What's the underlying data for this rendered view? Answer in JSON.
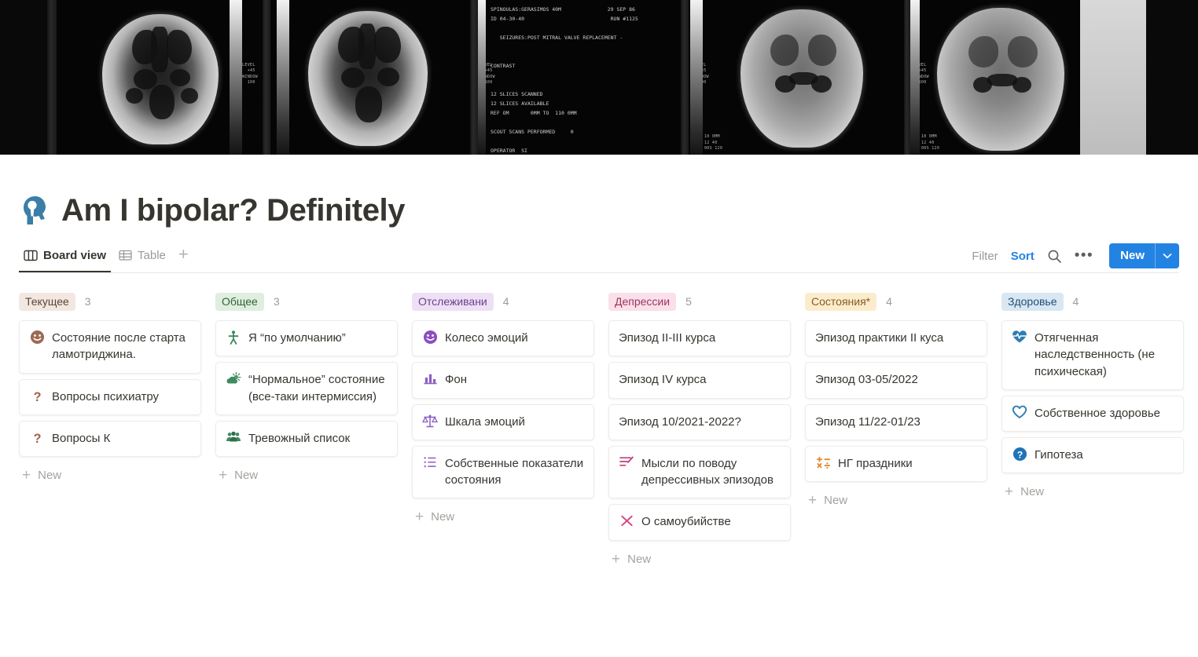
{
  "cover": {
    "alt": "ct-scan-film-cover",
    "scan_overlay_text": "SPINOULAS:GERASIMOS 40M               29 SEP 86\nID 04-30-40                            RUN #1125\n\n   SEIZURES:POST MITRAL VALVE REPLACEMENT -\n\n\nCONTRAST\n\n\n12 SLICES SCANNED\n12 SLICES AVAILABLE\nREF OM       0MM TO  110 0MM\n\nSCOUT SCANS PERFORMED     0\n\nOPERATOR  SI\nPHYSICIAN  JETT\nRADIOLOGIST  KRUDY",
    "side_label": "LEVEL\n  +45\nWINDOW\n  100",
    "corner_label": "10 0MM\n12 40\n00S 120"
  },
  "header": {
    "title": "Am I bipolar? Definitely",
    "icon": "head-keyhole-icon"
  },
  "viewbar": {
    "tabs": [
      {
        "label": "Board view",
        "icon": "board-view-icon",
        "active": true
      },
      {
        "label": "Table",
        "icon": "table-view-icon",
        "active": false
      }
    ],
    "add_view_label": "+",
    "toolbar": {
      "filter_label": "Filter",
      "sort_label": "Sort",
      "search_icon": "search-icon",
      "more_icon": "more-dots-icon",
      "new_label": "New",
      "new_caret_icon": "chevron-down-icon"
    }
  },
  "accent_colors": {
    "brand_blue": "#2383e2",
    "text": "#37352f",
    "muted": "#9b9a97"
  },
  "board": {
    "new_label": "New",
    "columns": [
      {
        "tag": "Текущее",
        "tag_bg": "#f3e7e1",
        "tag_fg": "#5b4438",
        "count": "3",
        "cards": [
          {
            "title": "Состояние после старта ламотриджина.",
            "icon": "smiley-face-icon",
            "icon_color": "#9b6b53"
          },
          {
            "title": "Вопросы психиатру",
            "icon": "question-mark-icon",
            "icon_color": "#a1644a"
          },
          {
            "title": "Вопросы К",
            "icon": "question-mark-icon",
            "icon_color": "#a1644a"
          }
        ]
      },
      {
        "tag": "Общее",
        "tag_bg": "#dfeede",
        "tag_fg": "#33623b",
        "count": "3",
        "cards": [
          {
            "title": "Я “по умолчанию”",
            "icon": "person-standing-icon",
            "icon_color": "#3d8a5f"
          },
          {
            "title": "“Нормальное” состояние (все-таки интермиссия)",
            "icon": "sun-behind-cloud-icon",
            "icon_color": "#3f8a62"
          },
          {
            "title": "Тревожный список",
            "icon": "people-group-icon",
            "icon_color": "#3f8a62"
          }
        ]
      },
      {
        "tag": "Отслеживани",
        "tag_bg": "#eee0f4",
        "tag_fg": "#6b3f8f",
        "count": "4",
        "cards": [
          {
            "title": "Колесо эмоций",
            "icon": "smiley-face-icon",
            "icon_color": "#8b4ec0"
          },
          {
            "title": "Фон",
            "icon": "bar-chart-icon",
            "icon_color": "#8b5fc4"
          },
          {
            "title": "Шкала эмоций",
            "icon": "balance-scale-icon",
            "icon_color": "#8b5fc4"
          },
          {
            "title": "Собственные показатели состояния",
            "icon": "bullet-list-icon",
            "icon_color": "#9a6ccc"
          }
        ]
      },
      {
        "tag": "Депрессии",
        "tag_bg": "#fae0e9",
        "tag_fg": "#9c3462",
        "count": "5",
        "cards": [
          {
            "title": "Эпизод II-III курса",
            "icon": "",
            "icon_color": ""
          },
          {
            "title": "Эпизод IV курса",
            "icon": "",
            "icon_color": ""
          },
          {
            "title": "Эпизод 10/2021-2022?",
            "icon": "",
            "icon_color": ""
          },
          {
            "title": "Мысли по поводу депрессивных эпизодов",
            "icon": "edit-note-icon",
            "icon_color": "#c1407f"
          },
          {
            "title": "О самоубийстве",
            "icon": "cross-x-icon",
            "icon_color": "#d6457f"
          }
        ]
      },
      {
        "tag": "Состояния*",
        "tag_bg": "#fbeccd",
        "tag_fg": "#8a5b22",
        "count": "4",
        "cards": [
          {
            "title": "Эпизод практики II куса",
            "icon": "",
            "icon_color": ""
          },
          {
            "title": "Эпизод 03-05/2022",
            "icon": "",
            "icon_color": ""
          },
          {
            "title": "Эпизод 11/22-01/23",
            "icon": "",
            "icon_color": ""
          },
          {
            "title": "НГ праздники",
            "icon": "math-symbols-icon",
            "icon_color": "#e08b2a"
          }
        ]
      },
      {
        "tag": "Здоровье",
        "tag_bg": "#d9e7f2",
        "tag_fg": "#1f4e79",
        "count": "4",
        "cards": [
          {
            "title": "Отягченная наследственность (не психическая)",
            "icon": "heart-pulse-icon",
            "icon_color": "#2d7cb5"
          },
          {
            "title": "Собственное здоровье",
            "icon": "heart-outline-icon",
            "icon_color": "#2d7cb5"
          },
          {
            "title": "Гипотеза",
            "icon": "question-circle-icon",
            "icon_color": "#1f74b8"
          }
        ]
      }
    ]
  }
}
